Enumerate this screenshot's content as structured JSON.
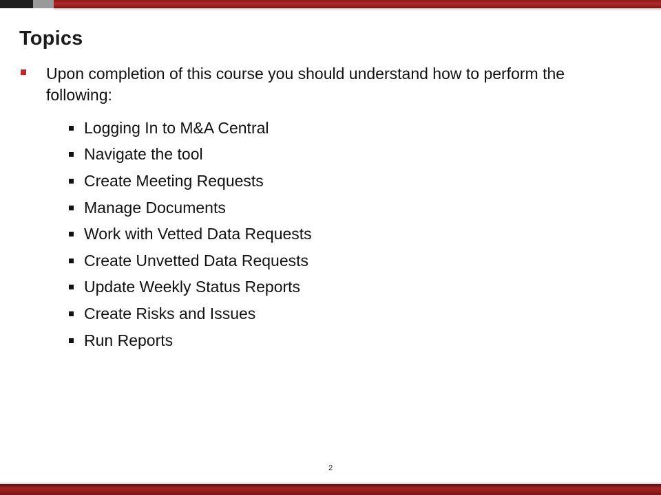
{
  "slide": {
    "title": "Topics",
    "intro": "Upon completion of this course you should understand how to perform the following:",
    "topics": [
      "Logging In to M&A Central",
      "Navigate the tool",
      "Create Meeting Requests",
      "Manage Documents",
      "Work with Vetted Data Requests",
      "Create Unvetted Data Requests",
      "Update Weekly Status Reports",
      "Create Risks and Issues",
      "Run Reports"
    ],
    "page_number": "2"
  },
  "colors": {
    "accent_red": "#c0282d",
    "band_red": "#a32424",
    "dark_block": "#1e1e1e",
    "gray_block": "#9a9a9a"
  }
}
